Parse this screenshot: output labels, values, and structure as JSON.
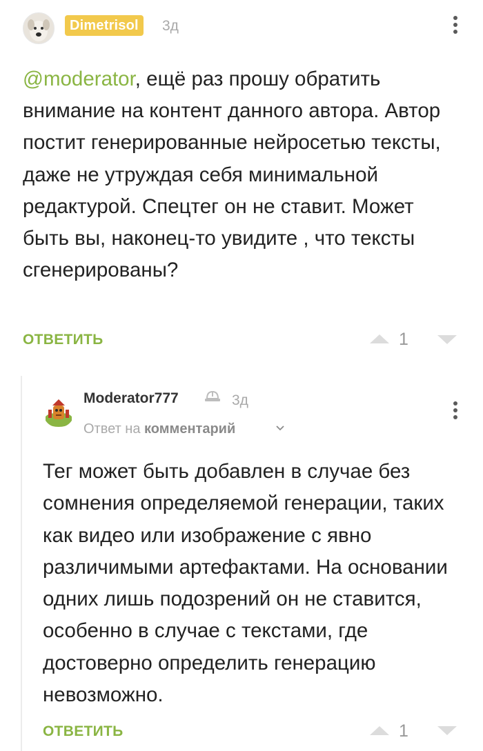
{
  "comments": [
    {
      "author": "Dimetrisol",
      "time": "3д",
      "mention": "@moderator",
      "text": ", ещё раз прошу обратить внимание на контент данного автора. Автор постит генерированные нейросетью тексты, даже не утруждая себя минимальной редактурой. Спецтег он не ставит. Может быть вы, наконец-то увидите , что тексты сгенерированы?",
      "reply_label": "ОТВЕТИТЬ",
      "score": "1",
      "icons": {
        "avatar": "dog-avatar-icon",
        "menu": "more-vertical-icon",
        "upvote": "upvote-triangle-icon",
        "downvote": "downvote-triangle-icon"
      }
    },
    {
      "author": "Moderator777",
      "time": "3д",
      "reply_to_prefix": "Ответ на",
      "reply_to_link": "комментарий",
      "text": "Тег может быть добавлен в случае без сомнения определяемой генерации, таких как видео или изображение с явно различимыми артефактами. На основании одних лишь подозрений он не ставится, особенно в случае с текстами, где достоверно определить генерацию невозможно.",
      "reply_label": "ОТВЕТИТЬ",
      "score": "1",
      "icons": {
        "avatar": "moderator-mascot-avatar-icon",
        "badge": "moderator-helmet-icon",
        "expand": "chevron-down-icon",
        "menu": "more-vertical-icon",
        "upvote": "upvote-triangle-icon",
        "downvote": "downvote-triangle-icon"
      }
    }
  ],
  "colors": {
    "accent": "#8ab543",
    "author_badge": "#f2c94c",
    "muted": "#a9a9a9",
    "arrow": "#dcdcdc"
  }
}
